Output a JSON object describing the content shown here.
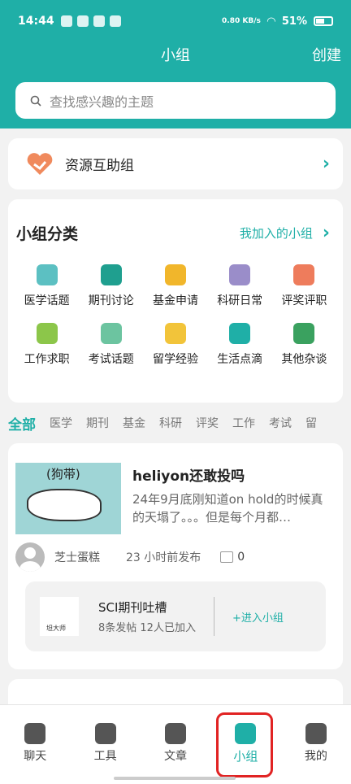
{
  "status": {
    "time": "14:44",
    "net_speed": "0.80 KB/s",
    "battery": "51%"
  },
  "header": {
    "title": "小组",
    "create": "创建"
  },
  "search": {
    "placeholder": "查找感兴趣的主题"
  },
  "resource": {
    "label": "资源互助组"
  },
  "categories": {
    "title": "小组分类",
    "my_groups": "我加入的小组",
    "items": [
      {
        "label": "医学话题",
        "icon": "mask-icon",
        "color": "#5cc0c2"
      },
      {
        "label": "期刊讨论",
        "icon": "bookmark-book-icon",
        "color": "#1f9f8f"
      },
      {
        "label": "基金申请",
        "icon": "yen-coin-icon",
        "color": "#f1b62b"
      },
      {
        "label": "科研日常",
        "icon": "scales-icon",
        "color": "#9a8dc9"
      },
      {
        "label": "评奖评职",
        "icon": "medal-icon",
        "color": "#ee7c5c"
      },
      {
        "label": "工作求职",
        "icon": "briefcase-icon",
        "color": "#8cc64a"
      },
      {
        "label": "考试话题",
        "icon": "scroll-icon",
        "color": "#6cc4a0"
      },
      {
        "label": "留学经验",
        "icon": "airplane-icon",
        "color": "#f2c43a"
      },
      {
        "label": "生活点滴",
        "icon": "bicycle-icon",
        "color": "#1fafa7"
      },
      {
        "label": "其他杂谈",
        "icon": "plant-icon",
        "color": "#3aa15f"
      }
    ]
  },
  "tabs": [
    "全部",
    "医学",
    "期刊",
    "基金",
    "科研",
    "评奖",
    "工作",
    "考试",
    "留"
  ],
  "post": {
    "thumb_text": "(狗带)",
    "title": "heliyon还敢投吗",
    "excerpt": "24年9月底刚知道on hold的时候真的天塌了。。。但是每个月都…",
    "author": "芝士蛋糕",
    "time": "23 小时前发布",
    "comments": "0",
    "group": {
      "name": "SCI期刊吐槽",
      "stats": "8条发帖  12人已加入",
      "join": "+进入小组"
    }
  },
  "colors": {
    "accent": "#1fafa7",
    "highlight": "#e12323"
  },
  "bottom_nav": [
    {
      "label": "聊天",
      "icon": "moon-chat-icon"
    },
    {
      "label": "工具",
      "icon": "pie-chart-icon"
    },
    {
      "label": "文章",
      "icon": "open-book-icon"
    },
    {
      "label": "小组",
      "icon": "people-icon",
      "active": true
    },
    {
      "label": "我的",
      "icon": "user-icon"
    }
  ]
}
